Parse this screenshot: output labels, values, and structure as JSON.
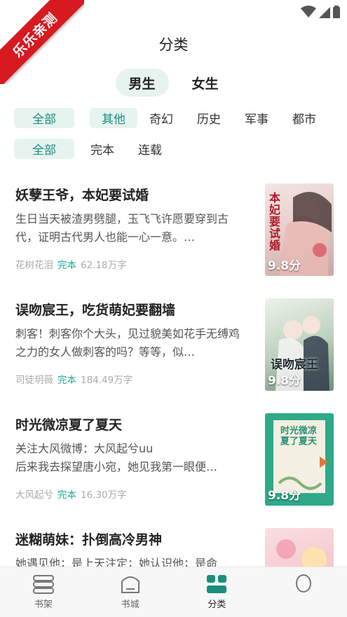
{
  "watermark": "乐乐亲测",
  "header": {
    "title": "分类"
  },
  "gender_tabs": [
    {
      "label": "男生",
      "active": true
    },
    {
      "label": "女生",
      "active": false
    }
  ],
  "category_filters": [
    {
      "label": "全部",
      "active": true
    },
    {
      "label": "其他",
      "active": true
    },
    {
      "label": "奇幻",
      "active": false
    },
    {
      "label": "历史",
      "active": false
    },
    {
      "label": "军事",
      "active": false
    },
    {
      "label": "都市",
      "active": false
    }
  ],
  "status_filters": [
    {
      "label": "全部",
      "active": true
    },
    {
      "label": "完本",
      "active": false
    },
    {
      "label": "连载",
      "active": false
    }
  ],
  "books": [
    {
      "title": "妖孽王爷，本妃要试婚",
      "description": "生日当天被渣男劈腿，玉飞飞许愿要穿到古代，证明古代男人也能一心一意。…",
      "author": "花树花泪",
      "status": "完本",
      "word_count": "62.18万字",
      "score": "9.8分",
      "cover_text": "本妃要试婚",
      "cover_colors": [
        "#f3e6e3",
        "#c9a7a3"
      ]
    },
    {
      "title": "误吻宸王，吃货萌妃要翻墙",
      "description": "刺客！刺客你个大头，见过貌美如花手无缚鸡之力的女人做刺客的吗？等等，似…",
      "author": "司徒玥薇",
      "status": "完本",
      "word_count": "184.49万字",
      "score": "9.8分",
      "cover_text": "误吻宸王",
      "cover_colors": [
        "#dfeadb",
        "#6f8f7a"
      ]
    },
    {
      "title": "时光微凉夏了夏天",
      "description": "关注大风微博：大风起兮uu\n后来我去探望唐小宛，她见我第一眼便…",
      "author": "大风起兮",
      "status": "完本",
      "word_count": "16.30万字",
      "score": "9.8分",
      "cover_text": "时光微凉夏了夏天",
      "cover_colors": [
        "#2fa98a",
        "#f3efe2"
      ]
    },
    {
      "title": "迷糊萌妹：扑倒高冷男神",
      "description": "她遇见他；是上天注定；她认识他；是命",
      "author": "",
      "status": "",
      "word_count": "",
      "score": "",
      "cover_text": "",
      "cover_colors": [
        "#f6c9cf",
        "#e58ea3"
      ]
    }
  ],
  "bottom_nav": [
    {
      "label": "书架",
      "icon": "bookshelf-icon",
      "active": false
    },
    {
      "label": "书城",
      "icon": "bookstore-icon",
      "active": false
    },
    {
      "label": "分类",
      "icon": "category-grid-icon",
      "active": true
    },
    {
      "label": "",
      "icon": "profile-icon",
      "active": false
    }
  ],
  "colors": {
    "accent": "#1a8f7e",
    "chip_bg": "#e7f3ef",
    "watermark_red": "#d71920"
  }
}
